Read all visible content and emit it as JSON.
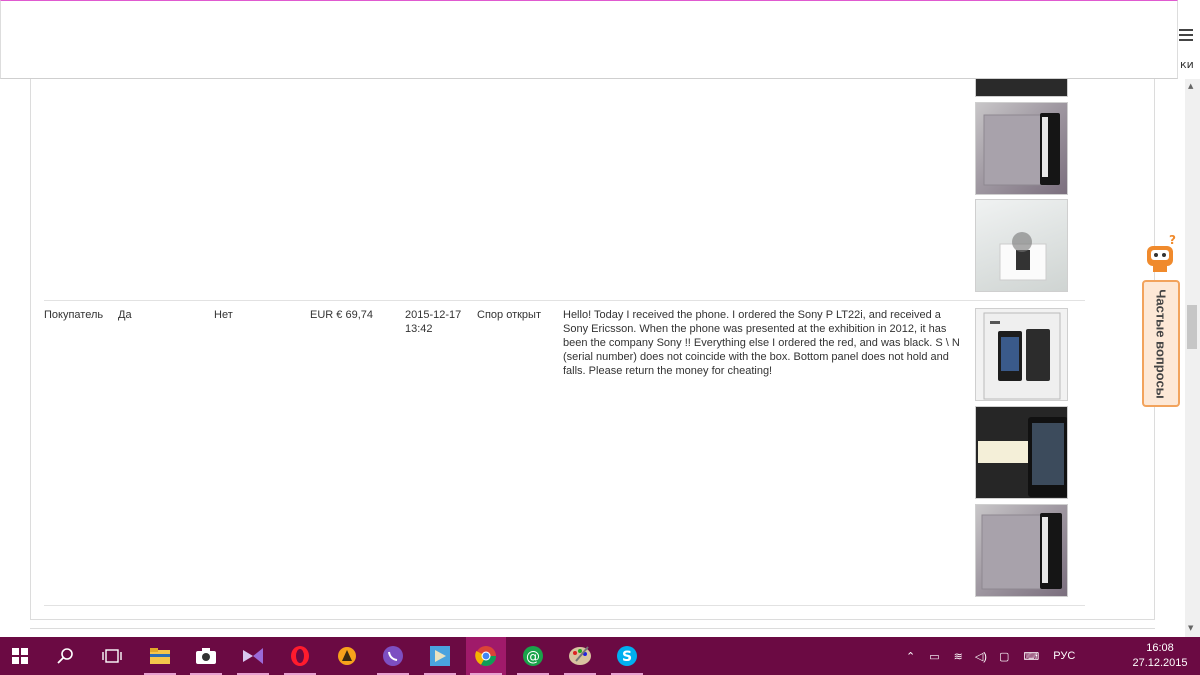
{
  "header": {
    "menu_text": "ки"
  },
  "table": {
    "row": {
      "role": "Покупатель",
      "col2": "Да",
      "col3": "Нет",
      "amount": "EUR € 69,74",
      "date": "2015-12-17",
      "time": "13:42",
      "status": "Спор открыт",
      "message": "Hello! Today I received the phone. I ordered the Sony P LT22i, and received a Sony Ericsson. When the phone was presented at the exhibition in 2012, it has been the company Sony !! Everything else I ordered the red, and was black. S \\ N (serial number) does not coincide with the box. Bottom panel does not hold and falls. Please return the money for cheating!"
    }
  },
  "faq": {
    "label": "Частые вопросы"
  },
  "taskbar": {
    "apps": [
      "start-icon",
      "search-icon",
      "task-view-icon",
      "file-explorer-icon",
      "camera-icon",
      "visual-studio-icon",
      "opera-icon",
      "avast-icon",
      "viber-icon",
      "play-store-icon",
      "chrome-icon",
      "mail-agent-icon",
      "paint-icon",
      "skype-icon"
    ],
    "language": "РУС",
    "time": "16:08",
    "date": "27.12.2015"
  },
  "colors": {
    "taskbar": "#6b0a43",
    "taskbar_active": "#a01a6a",
    "faq_border": "#f2a35c",
    "faq_bg": "#fde8d6"
  }
}
